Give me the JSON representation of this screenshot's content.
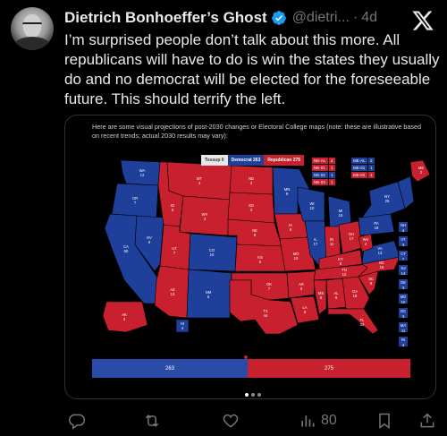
{
  "author": {
    "name": "Dietrich Bonhoeffer’s Ghost",
    "handle": "@dietri...",
    "separator": "·",
    "time": "4d",
    "verified": true
  },
  "tweet": {
    "text": "I’m surprised people don’t talk about this more. All republicans will have to do is win the states they usually do and no democrat will be elected for the foreseeable future. This should terrify the left."
  },
  "media": {
    "caption": "Here are some visual projections of post-2030 changes or Electoral College maps (note: these are illustrative based on recent trends; actual 2030 results may vary):",
    "legend": {
      "tossup": "Tossup 0",
      "democrat": "Democrat 263",
      "republican": "Republican 275"
    },
    "states": [
      {
        "abbr": "WA",
        "ev": "12",
        "party": "dem"
      },
      {
        "abbr": "OR",
        "ev": "7",
        "party": "dem"
      },
      {
        "abbr": "CA",
        "ev": "50",
        "party": "dem"
      },
      {
        "abbr": "NV",
        "ev": "6",
        "party": "dem"
      },
      {
        "abbr": "ID",
        "ev": "5",
        "party": "rep"
      },
      {
        "abbr": "MT",
        "ev": "4",
        "party": "rep"
      },
      {
        "abbr": "WY",
        "ev": "3",
        "party": "rep"
      },
      {
        "abbr": "UT",
        "ev": "7",
        "party": "rep"
      },
      {
        "abbr": "AZ",
        "ev": "13",
        "party": "rep"
      },
      {
        "abbr": "CO",
        "ev": "10",
        "party": "dem"
      },
      {
        "abbr": "NM",
        "ev": "5",
        "party": "dem"
      },
      {
        "abbr": "ND",
        "ev": "3",
        "party": "rep"
      },
      {
        "abbr": "SD",
        "ev": "3",
        "party": "rep"
      },
      {
        "abbr": "NE",
        "ev": "5",
        "party": "rep"
      },
      {
        "abbr": "KS",
        "ev": "6",
        "party": "rep"
      },
      {
        "abbr": "OK",
        "ev": "7",
        "party": "rep"
      },
      {
        "abbr": "TX",
        "ev": "44",
        "party": "rep"
      },
      {
        "abbr": "MN",
        "ev": "9",
        "party": "dem"
      },
      {
        "abbr": "IA",
        "ev": "6",
        "party": "rep"
      },
      {
        "abbr": "MO",
        "ev": "10",
        "party": "rep"
      },
      {
        "abbr": "AR",
        "ev": "6",
        "party": "rep"
      },
      {
        "abbr": "LA",
        "ev": "8",
        "party": "rep"
      },
      {
        "abbr": "WI",
        "ev": "10",
        "party": "dem"
      },
      {
        "abbr": "IL",
        "ev": "17",
        "party": "dem"
      },
      {
        "abbr": "MI",
        "ev": "15",
        "party": "dem"
      },
      {
        "abbr": "IN",
        "ev": "11",
        "party": "rep"
      },
      {
        "abbr": "OH",
        "ev": "17",
        "party": "rep"
      },
      {
        "abbr": "KY",
        "ev": "8",
        "party": "rep"
      },
      {
        "abbr": "TN",
        "ev": "12",
        "party": "rep"
      },
      {
        "abbr": "MS",
        "ev": "6",
        "party": "rep"
      },
      {
        "abbr": "AL",
        "ev": "9",
        "party": "rep"
      },
      {
        "abbr": "GA",
        "ev": "16",
        "party": "rep"
      },
      {
        "abbr": "FL",
        "ev": "33",
        "party": "rep"
      },
      {
        "abbr": "SC",
        "ev": "9",
        "party": "rep"
      },
      {
        "abbr": "NC",
        "ev": "16",
        "party": "rep"
      },
      {
        "abbr": "VA",
        "ev": "13",
        "party": "dem"
      },
      {
        "abbr": "WV",
        "ev": "4",
        "party": "rep"
      },
      {
        "abbr": "PA",
        "ev": "18",
        "party": "dem"
      },
      {
        "abbr": "NY",
        "ev": "25",
        "party": "dem"
      },
      {
        "abbr": "ME",
        "ev": "2",
        "party": "dem"
      },
      {
        "abbr": "AK",
        "ev": "3",
        "party": "rep"
      },
      {
        "abbr": "HI",
        "ev": "4",
        "party": "dem"
      }
    ],
    "splits": [
      {
        "label": "NE-AL",
        "ev": "2",
        "party": "rep"
      },
      {
        "label": "NE-01",
        "ev": "1",
        "party": "rep"
      },
      {
        "label": "NE-02",
        "ev": "1",
        "party": "dem"
      },
      {
        "label": "NE-03",
        "ev": "1",
        "party": "rep"
      },
      {
        "label": "ME-AL",
        "ev": "2",
        "party": "dem"
      },
      {
        "label": "ME-01",
        "ev": "1",
        "party": "dem"
      },
      {
        "label": "ME-02",
        "ev": "1",
        "party": "rep"
      }
    ],
    "small_states": [
      {
        "abbr": "NH",
        "ev": "4",
        "party": "dem"
      },
      {
        "abbr": "VT",
        "ev": "3",
        "party": "dem"
      },
      {
        "abbr": "CT",
        "ev": "7",
        "party": "dem"
      },
      {
        "abbr": "NJ",
        "ev": "14",
        "party": "dem"
      },
      {
        "abbr": "DE",
        "ev": "3",
        "party": "dem"
      },
      {
        "abbr": "MD",
        "ev": "10",
        "party": "dem"
      },
      {
        "abbr": "DC",
        "ev": "3",
        "party": "dem"
      },
      {
        "abbr": "MA",
        "ev": "11",
        "party": "dem"
      },
      {
        "abbr": "RI",
        "ev": "4",
        "party": "dem"
      }
    ],
    "ev_bar": {
      "democrat": "263",
      "republican": "275",
      "dem_total": 263,
      "rep_total": 275
    },
    "colors": {
      "democrat": "#1e3f9a",
      "republican": "#c8202f",
      "tossup": "#e8e8e8"
    }
  },
  "carousel": {
    "count": 3,
    "active": 0
  },
  "actions": {
    "reply": "",
    "retweet": "",
    "like": "",
    "views": "80",
    "bookmark": "",
    "share": ""
  }
}
